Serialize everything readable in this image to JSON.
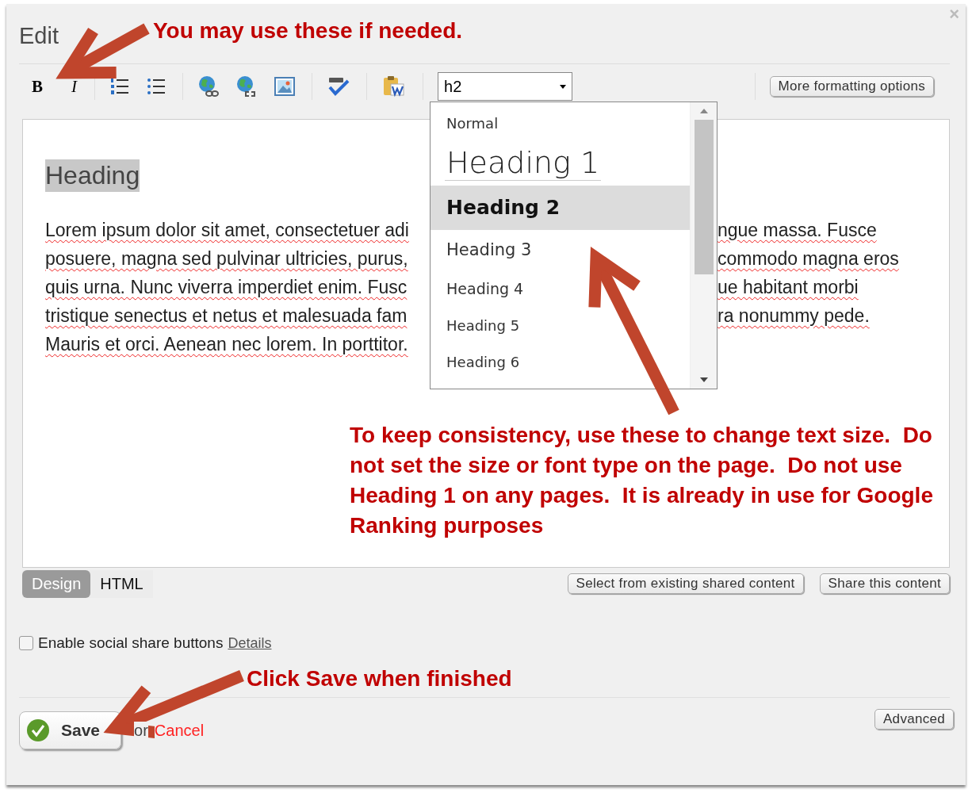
{
  "window": {
    "title": "Edit",
    "close": "×"
  },
  "toolbar": {
    "groups": [
      [
        {
          "kind": "bold",
          "label": "B"
        },
        {
          "kind": "italic",
          "label": "I"
        }
      ],
      [
        {
          "kind": "ordered-list"
        },
        {
          "kind": "bullet-list"
        }
      ],
      [
        {
          "kind": "link"
        },
        {
          "kind": "unlink"
        },
        {
          "kind": "image"
        }
      ],
      [
        {
          "kind": "spellcheck"
        }
      ],
      [
        {
          "kind": "paste-word"
        }
      ]
    ],
    "format_select": {
      "value": "h2",
      "expanded": true
    },
    "more_button": "More formatting options"
  },
  "format_options": [
    {
      "kind": "normal",
      "label": "Normal",
      "selected": false
    },
    {
      "kind": "h1",
      "label": "Heading 1",
      "selected": false
    },
    {
      "kind": "h2",
      "label": "Heading 2",
      "selected": true
    },
    {
      "kind": "h3",
      "label": "Heading 3",
      "selected": false
    },
    {
      "kind": "h4",
      "label": "Heading 4",
      "selected": false
    },
    {
      "kind": "h5",
      "label": "Heading 5",
      "selected": false
    },
    {
      "kind": "h6",
      "label": "Heading 6",
      "selected": false
    }
  ],
  "editor": {
    "heading": "Heading",
    "lines": [
      {
        "left": "Lorem ipsum dolor sit amet, consectetuer adi",
        "right": "ngue massa. Fusce"
      },
      {
        "left": "posuere, magna sed pulvinar ultricies, purus,",
        "right": "commodo magna eros"
      },
      {
        "left": "quis urna. Nunc viverra imperdiet enim. Fusc",
        "right": "ue habitant morbi"
      },
      {
        "left": "tristique senectus et netus et malesuada fam",
        "right": "ra nonummy pede."
      },
      {
        "left": "Mauris et orci. Aenean nec lorem. In porttitor."
      }
    ]
  },
  "view_tabs": [
    {
      "label": "Design",
      "selected": true
    },
    {
      "label": "HTML",
      "selected": false
    }
  ],
  "content_buttons": [
    "Select from existing shared content",
    "Share this content"
  ],
  "social_share": {
    "label": "Enable social share buttons",
    "checked": false,
    "link": "Details"
  },
  "footer": {
    "save": "Save",
    "or": "or",
    "cancel": "Cancel",
    "advanced": "Advanced"
  },
  "annotations": [
    {
      "text": "You may use these if needed."
    },
    {
      "text": "To keep consistency, use these to change text size.  Do not set the size or font type on the page.  Do not use Heading 1 on any pages.  It is already in use for Google Ranking purposes"
    },
    {
      "text": "Click Save when finished"
    }
  ]
}
